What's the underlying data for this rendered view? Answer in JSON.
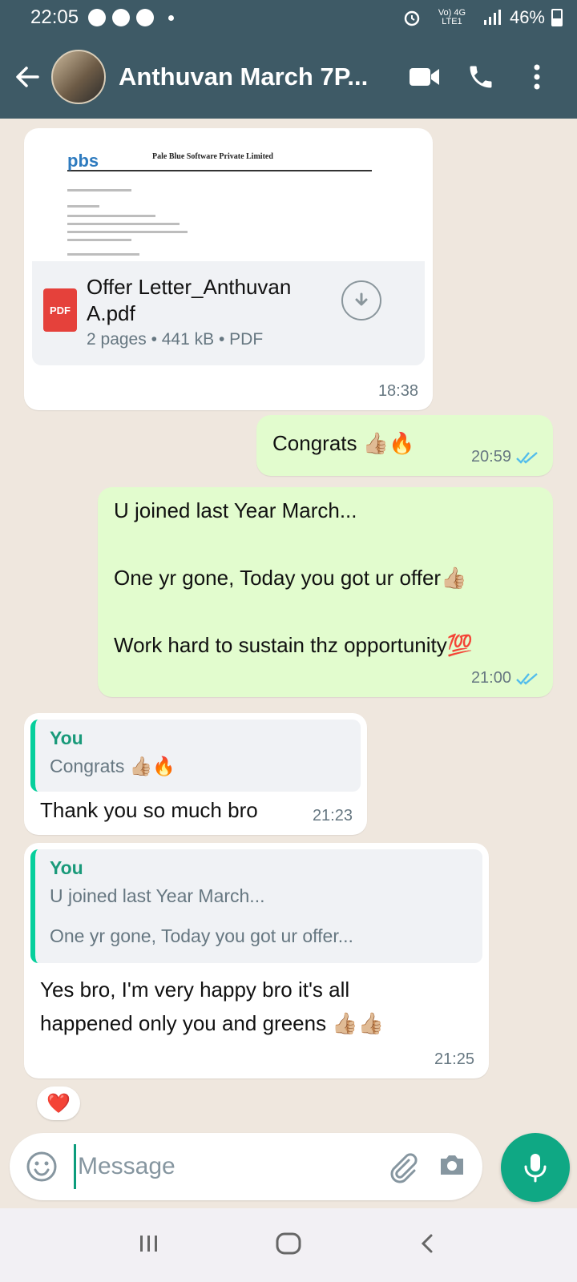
{
  "status_bar": {
    "time": "22:05",
    "network": "Vo) 4G LTE1",
    "battery": "46%"
  },
  "app_bar": {
    "title": "Anthuvan March 7P..."
  },
  "colors": {
    "app_bar": "#3e5a66",
    "chat_bg": "#efe7de",
    "outgoing_bubble": "#e2fcce",
    "accent": "#0fa884",
    "read_ticks": "#53bdeb"
  },
  "messages": {
    "document": {
      "letterhead_logo": "pbs",
      "letterhead_company": "Pale Blue Software Private Limited",
      "file_name": "Offer Letter_Anthuvan A.pdf",
      "file_type_badge": "PDF",
      "details": "2 pages • 441 kB • PDF",
      "time": "18:38"
    },
    "congrats": {
      "text": "Congrats 👍🏼🔥",
      "time": "20:59"
    },
    "advice": {
      "line1": "U joined last Year March...",
      "line2": "One yr gone, Today you got ur offer👍🏼",
      "line3": "Work hard to sustain thz opportunity💯",
      "time": "21:00"
    },
    "reply1": {
      "quote_author": "You",
      "quote_text": "Congrats 👍🏼🔥",
      "text": "Thank you so much bro",
      "time": "21:23"
    },
    "reply2": {
      "quote_author": "You",
      "quote_line1": "U joined last Year March...",
      "quote_line2": "One yr gone, Today you got ur offer...",
      "text_line1": "Yes bro, I'm very happy bro it's all",
      "text_line2": "happened only you and greens 👍🏼👍🏼",
      "time": "21:25",
      "reaction": "❤️"
    }
  },
  "composer": {
    "placeholder": "Message"
  }
}
